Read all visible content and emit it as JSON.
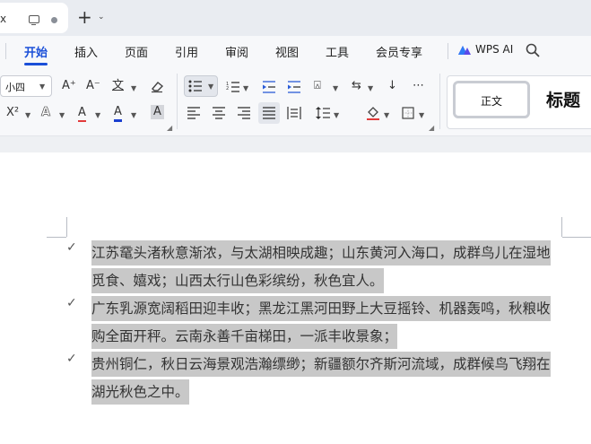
{
  "tab_bar": {
    "close_glyph": "x",
    "new_tab_glyph": "+",
    "new_tab_arrow": "⌄"
  },
  "menu": {
    "items": [
      "开始",
      "插入",
      "页面",
      "引用",
      "审阅",
      "视图",
      "工具",
      "会员专享"
    ],
    "active_index": 0,
    "ai_label": "WPS AI"
  },
  "ribbon": {
    "font_size_value": "小四",
    "grow_font": "A⁺",
    "shrink_font": "A⁻",
    "phonetic": "文",
    "superscript": "X²",
    "text_effect": "A",
    "highlight": "A",
    "font_color": "A",
    "char_shade": "A",
    "styles": {
      "normal": "正文",
      "heading": "标题"
    }
  },
  "document": {
    "paragraphs": [
      {
        "lines": [
          "江苏鼋头渚秋意渐浓，与太湖相映成趣；山东黄河入海口，成群鸟儿在湿地",
          "觅食、嬉戏；山西太行山色彩缤纷，秋色宜人。"
        ]
      },
      {
        "lines": [
          "广东乳源宽阔稻田迎丰收；黑龙江黑河田野上大豆摇铃、机器轰鸣，秋粮收",
          "购全面开秤。云南永善千亩梯田，一派丰收景象；"
        ]
      },
      {
        "lines": [
          "贵州铜仁，秋日云海景观浩瀚缥缈；新疆额尔齐斯河流域，成群候鸟飞翔在",
          "湖光秋色之中。"
        ]
      }
    ]
  },
  "colors": {
    "accent": "#1a4fd8",
    "selection": "#c8c8c8",
    "font_color_bar": "#1a3fd0",
    "highlight_bar": "#e23b3b"
  }
}
